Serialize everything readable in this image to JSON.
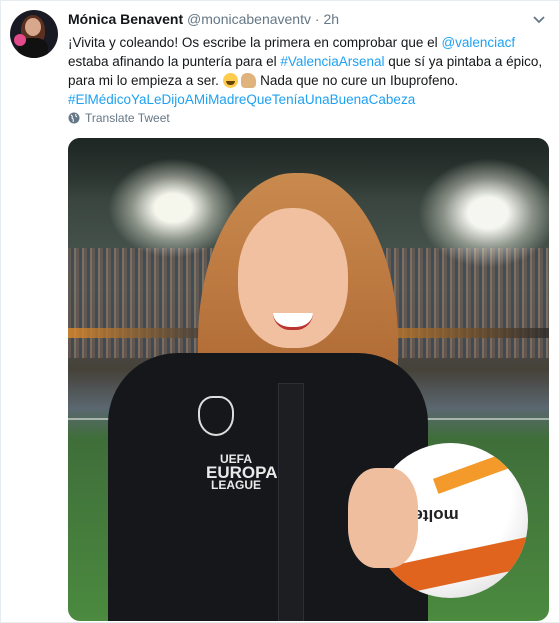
{
  "tweet": {
    "display_name": "Mónica Benavent",
    "handle": "@monicabenaventv",
    "separator": "·",
    "time": "2h",
    "text": {
      "line1_a": "¡Vivita y coleando! Os escribe la primera en comprobar que el ",
      "mention": "@valenciacf",
      "line1_b": " estaba afinando la puntería para el ",
      "hashtag1": "#ValenciaArsenal",
      "line1_c": " que sí ya pintaba a épico, para mi lo empieza a ser. ",
      "line1_d": " Nada que no cure un Ibuprofeno.",
      "hashtag2": "#ElMédicoYaLeDijoAMiMadreQueTeníaUnaBuenaCabeza"
    },
    "translate_label": "Translate Tweet",
    "emojis": [
      "rolling-on-floor-laughing",
      "flexed-biceps"
    ]
  },
  "photo": {
    "jacket_brand_line1": "UEFA",
    "jacket_brand_line2": "EUROPA",
    "jacket_brand_line3": "LEAGUE",
    "ball_brand": "molten"
  },
  "colors": {
    "link": "#1da1f2",
    "secondary_text": "#657786",
    "primary_text": "#14171a"
  }
}
